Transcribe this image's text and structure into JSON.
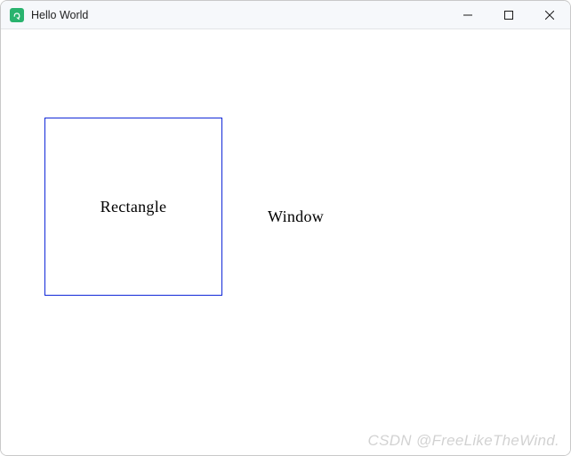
{
  "titlebar": {
    "title": "Hello World",
    "app_icon": "qt-icon",
    "min_icon": "minimize-icon",
    "max_icon": "maximize-icon",
    "close_icon": "close-icon"
  },
  "content": {
    "rectangle_label": "Rectangle",
    "window_label": "Window",
    "rectangle_border_color": "#1128d8"
  },
  "watermark": "CSDN @FreeLikeTheWind."
}
